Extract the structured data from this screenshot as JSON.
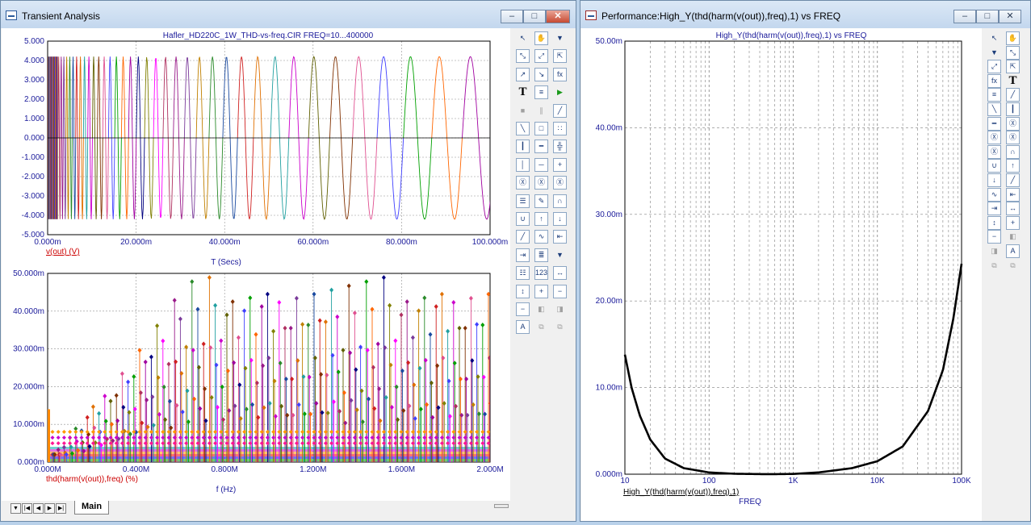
{
  "left_window": {
    "title": "Transient Analysis",
    "icon": "analysis-window-icon",
    "controls": {
      "minimize": "–",
      "maximize": "□",
      "close": "✕"
    },
    "top_plot": {
      "title": "Hafler_HD220C_1W_THD-vs-freq.CIR FREQ=10...400000",
      "y_ticks": [
        "5.000",
        "4.000",
        "3.000",
        "2.000",
        "1.000",
        "0.000",
        "-1.000",
        "-2.000",
        "-3.000",
        "-4.000",
        "-5.000"
      ],
      "x_ticks": [
        "0.000m",
        "20.000m",
        "40.000m",
        "60.000m",
        "80.000m",
        "100.000m"
      ],
      "trace_label": "v(out) (V)",
      "xlabel": "T (Secs)"
    },
    "bottom_plot": {
      "y_ticks": [
        "50.000m",
        "40.000m",
        "30.000m",
        "20.000m",
        "10.000m",
        "0.000m"
      ],
      "x_ticks": [
        "0.000M",
        "0.400M",
        "0.800M",
        "1.200M",
        "1.600M",
        "2.000M"
      ],
      "trace_label": "thd(harm(v(out)),freq) (%)",
      "xlabel": "f (Hz)"
    },
    "tabs": {
      "nav": [
        "▼",
        "|◀",
        "◀",
        "▶",
        "▶|"
      ],
      "items": [
        "Main"
      ]
    }
  },
  "right_window": {
    "title": "Performance:High_Y(thd(harm(v(out)),freq),1) vs FREQ",
    "icon": "performance-window-icon",
    "controls": {
      "minimize": "–",
      "maximize": "□",
      "close": "✕"
    },
    "plot": {
      "title": "High_Y(thd(harm(v(out)),freq),1) vs FREQ",
      "trace_label": "High_Y(thd(harm(v(out)),freq),1)",
      "xlabel": "FREQ"
    }
  },
  "chart_data": [
    {
      "type": "line",
      "title": "Hafler_HD220C_1W_THD-vs-freq.CIR FREQ=10...400000",
      "xlabel": "T (Secs)",
      "series": [
        {
          "name": "v(out) (V)",
          "amplitude": 4.2
        }
      ],
      "xlim": [
        0,
        0.1
      ],
      "ylim": [
        -5,
        5
      ],
      "grid": true
    },
    {
      "type": "scatter",
      "xlabel": "f (Hz)",
      "series": [
        {
          "name": "thd(harm(v(out)),freq) (%)",
          "ymax": 0.05
        }
      ],
      "xlim": [
        0,
        2000000
      ],
      "ylim": [
        0,
        0.05
      ],
      "grid": true
    },
    {
      "type": "line",
      "title": "High_Y(thd(harm(v(out)),freq),1) vs FREQ",
      "xlabel": "FREQ",
      "x_scale": "log",
      "x_ticks": [
        "10",
        "100",
        "1K",
        "10K",
        "100K"
      ],
      "y_ticks": [
        "50.00m",
        "40.00m",
        "30.00m",
        "20.00m",
        "10.00m",
        "0.000m"
      ],
      "xlim": [
        10,
        100000
      ],
      "ylim": [
        0,
        0.05
      ],
      "series": [
        {
          "name": "High_Y(thd(harm(v(out)),freq),1)",
          "x": [
            10,
            12,
            15,
            20,
            30,
            50,
            100,
            200,
            500,
            1000,
            2000,
            5000,
            10000,
            20000,
            40000,
            60000,
            80000,
            100000
          ],
          "y": [
            0.0138,
            0.01,
            0.0068,
            0.004,
            0.0018,
            0.0007,
            0.0002,
            5e-05,
            0.0,
            3e-05,
            0.0002,
            0.0007,
            0.0015,
            0.0032,
            0.0073,
            0.012,
            0.018,
            0.0243
          ]
        }
      ],
      "grid": true
    }
  ],
  "colors": {
    "grid": "#909090",
    "axis_text": "#1a1a9a",
    "trace_label": "#cc0000",
    "perf_trace": "#000000",
    "title_blue": "#1a1a9a"
  },
  "left_toolbar": [
    "select-arrow-icon",
    "hand-tool-icon",
    "dropdown-arrow-icon",
    "scale-icon",
    "rescale-icon",
    "zoom-fit-icon",
    "cursor-icon",
    "cursor-alt-icon",
    "fx-function-icon",
    "text-tool-icon",
    "properties-icon",
    "run-icon",
    "stop-icon",
    "pause-icon",
    "line-draw-icon",
    "line-draw-alt-icon",
    "frame-icon",
    "grid-dots-icon",
    "vertical-grid-icon",
    "horizontal-grid-icon",
    "both-grid-icon",
    "vertical-minor-icon",
    "horizontal-line-icon",
    "crosshair-icon",
    "magnify-1-icon",
    "magnify-2-icon",
    "magnify-3-icon",
    "stack-icon",
    "edit-icon",
    "peak-icon",
    "valley-icon",
    "high-icon",
    "low-icon",
    "slope-icon",
    "inflection-icon",
    "next-left-icon",
    "next-right-icon",
    "trace-menu-icon",
    "dropdown-arrow-icon",
    "data-table-icon",
    "number-table-icon",
    "fit-x-icon",
    "fit-y-icon",
    "zoom-in-icon",
    "zoom-out-icon",
    "zoom-out-alt-icon",
    "pan-left-icon",
    "pan-right-icon",
    "font-icon",
    "copy-icon",
    "paste-icon"
  ],
  "right_toolbar": [
    "select-arrow-icon",
    "hand-tool-icon",
    "dropdown-arrow-icon",
    "scale-icon",
    "rescale-icon",
    "zoom-fit-icon",
    "fx-function-icon",
    "text-tool-icon",
    "properties-icon",
    "line-draw-icon",
    "line-draw-alt-icon",
    "vertical-grid-icon",
    "horizontal-grid-icon",
    "magnify-1-icon",
    "magnify-2-icon",
    "magnify-3-icon",
    "magnify-4-icon",
    "peak-icon",
    "valley-icon",
    "high-icon",
    "low-icon",
    "slope-icon",
    "inflection-icon",
    "next-left-icon",
    "next-right-icon",
    "fit-x-icon",
    "fit-y-icon",
    "zoom-in-icon",
    "zoom-out-icon",
    "pan-left-icon",
    "pan-right-icon",
    "font-icon",
    "copy-icon",
    "paste-icon"
  ]
}
